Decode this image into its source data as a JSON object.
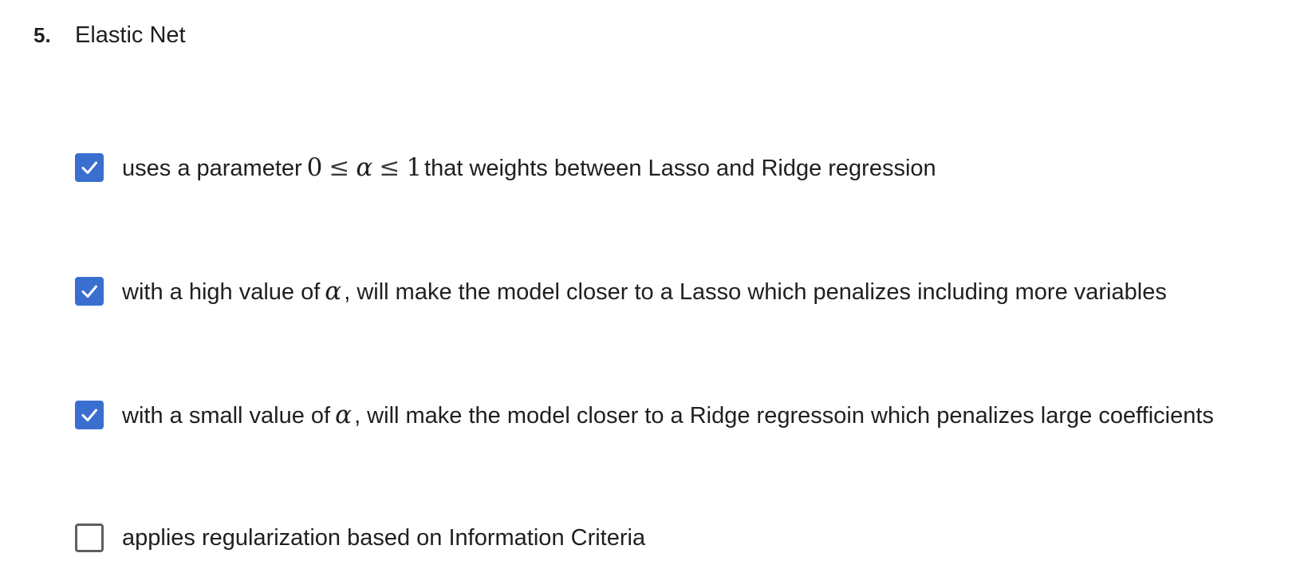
{
  "question": {
    "number": "5.",
    "title": "Elastic Net"
  },
  "options": [
    {
      "checked": true,
      "text_before": "uses a parameter",
      "math": {
        "lower": "0",
        "rel1": "≤",
        "symbol": "α",
        "rel2": "≤",
        "upper": "1"
      },
      "text_after": "that weights between Lasso and Ridge regression"
    },
    {
      "checked": true,
      "text_before": "with a high value of",
      "math_symbol": "α",
      "text_after": ", will make the model closer to a Lasso which penalizes including more variables"
    },
    {
      "checked": true,
      "text_before": "with a small value of",
      "math_symbol": "α",
      "text_after": ", will make the model closer to a Ridge regressoin which penalizes large coefficients"
    },
    {
      "checked": false,
      "text": "applies regularization based on Information Criteria"
    }
  ],
  "colors": {
    "checkbox_checked": "#3a6fd0",
    "checkbox_unchecked_border": "#5f5f5f",
    "text": "#1f1f1f"
  }
}
